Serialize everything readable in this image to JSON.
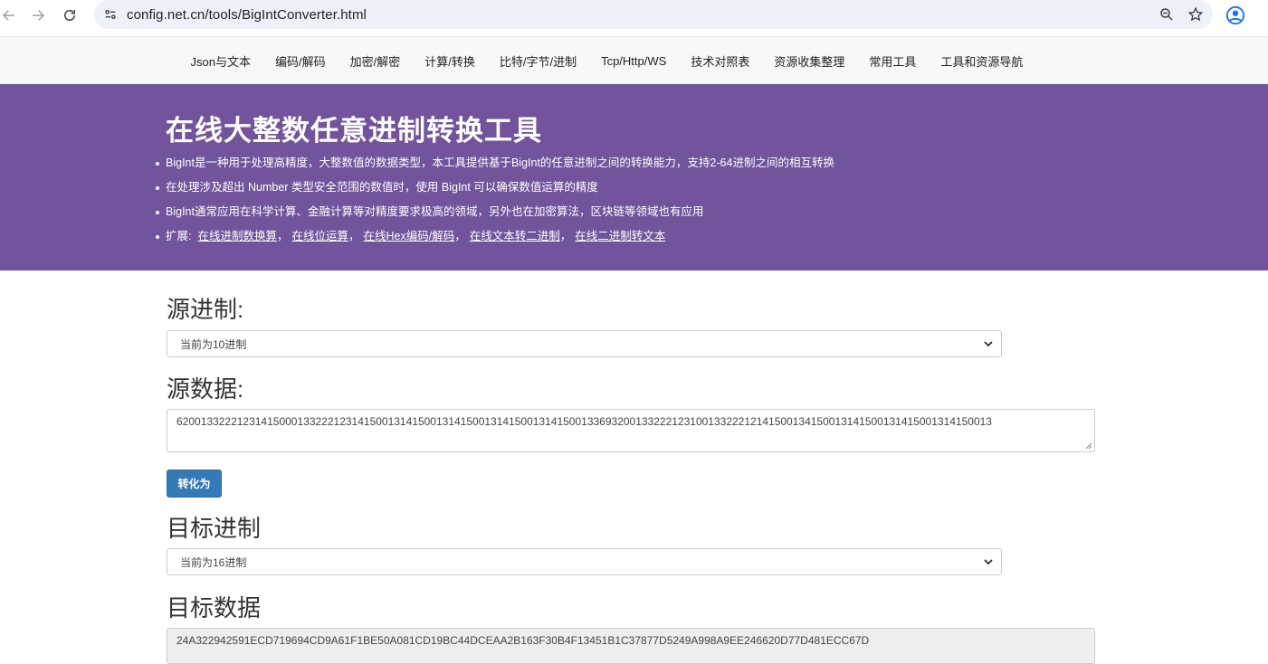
{
  "browser": {
    "url": "config.net.cn/tools/BigIntConverter.html"
  },
  "nav": {
    "items": [
      "Json与文本",
      "编码/解码",
      "加密/解密",
      "计算/转换",
      "比特/字节/进制",
      "Tcp/Http/WS",
      "技术对照表",
      "资源收集整理",
      "常用工具",
      "工具和资源导航"
    ]
  },
  "hero": {
    "title": "在线大整数任意进制转换工具",
    "bullet1": "BigInt是一种用于处理高精度，大整数值的数据类型，本工具提供基于BigInt的任意进制之间的转换能力，支持2-64进制之间的相互转换",
    "bullet2": "在处理涉及超出 Number 类型安全范围的数值时，使用 BigInt 可以确保数值运算的精度",
    "bullet3": "BigInt通常应用在科学计算、金融计算等对精度要求极高的领域，另外也在加密算法，区块链等领域也有应用",
    "ext_prefix": "扩展:",
    "links": [
      "在线进制数换算",
      "在线位运算",
      "在线Hex编码/解码",
      "在线文本转二进制",
      "在线二进制转文本"
    ],
    "link_seps": [
      "，",
      "，",
      "，",
      "，"
    ]
  },
  "source": {
    "label": "源进制:",
    "select_value": "当前为10进制",
    "data_label": "源数据:",
    "data_value": "620013322212314150001332221231415001314150013141500131415001314150013369320013322212310013322212141500134150013141500131415001314150013"
  },
  "convert_button": "转化为",
  "target": {
    "label": "目标进制",
    "select_value": "当前为16进制",
    "data_label": "目标数据",
    "data_value": "24A322942591ECD719694CD9A61F1BE50A081CD19BC44DCEAA2B163F30B4F13451B1C37877D5249A998A9EE246620D77D481ECC67D"
  },
  "colors": {
    "hero_bg": "#71549b",
    "button_bg": "#337ab7"
  }
}
